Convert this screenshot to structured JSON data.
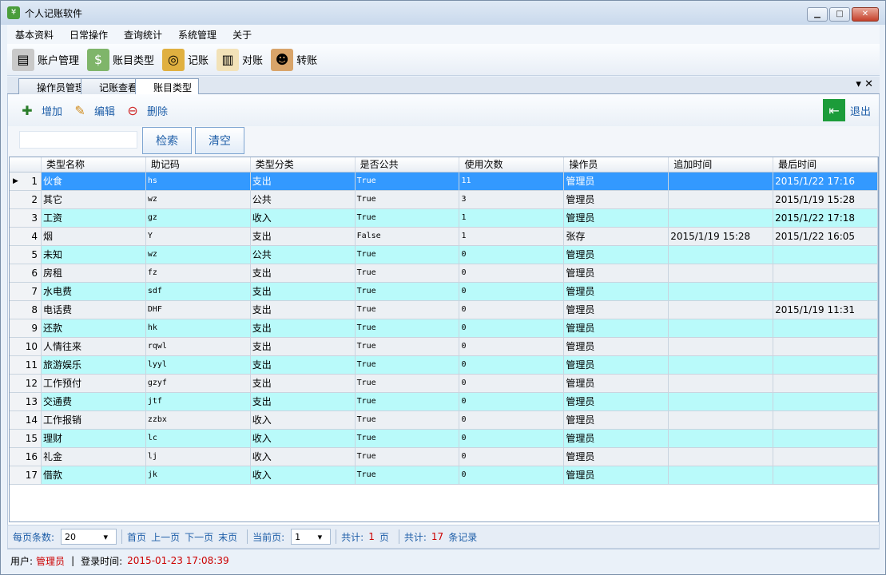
{
  "window": {
    "title": "个人记账软件"
  },
  "menu": [
    "基本资料",
    "日常操作",
    "查询统计",
    "系统管理",
    "关于"
  ],
  "toolbar": [
    {
      "label": "账户管理",
      "icon": "server-icon"
    },
    {
      "label": "账目类型",
      "icon": "money-icon"
    },
    {
      "label": "记账",
      "icon": "coins-icon"
    },
    {
      "label": "对账",
      "icon": "book-icon"
    },
    {
      "label": "转账",
      "icon": "person-briefcase-icon"
    }
  ],
  "tabs": [
    "操作员管理",
    "记账查看",
    "账目类型"
  ],
  "content_toolbar": {
    "add": "增加",
    "edit": "编辑",
    "delete": "删除",
    "exit": "退出"
  },
  "search": {
    "search_label": "检索",
    "clear_label": "清空"
  },
  "grid": {
    "columns": [
      "类型名称",
      "助记码",
      "类型分类",
      "是否公共",
      "使用次数",
      "操作员",
      "追加时间",
      "最后时间"
    ],
    "rows": [
      [
        "1",
        "伙食",
        "hs",
        "支出",
        "True",
        "11",
        "管理员",
        "",
        "2015/1/22 17:16"
      ],
      [
        "2",
        "其它",
        "wz",
        "公共",
        "True",
        "3",
        "管理员",
        "",
        "2015/1/19 15:28"
      ],
      [
        "3",
        "工资",
        "gz",
        "收入",
        "True",
        "1",
        "管理员",
        "",
        "2015/1/22 17:18"
      ],
      [
        "4",
        "烟",
        "Y",
        "支出",
        "False",
        "1",
        "张存",
        "2015/1/19 15:28",
        "2015/1/22 16:05"
      ],
      [
        "5",
        "未知",
        "wz",
        "公共",
        "True",
        "0",
        "管理员",
        "",
        ""
      ],
      [
        "6",
        "房租",
        "fz",
        "支出",
        "True",
        "0",
        "管理员",
        "",
        ""
      ],
      [
        "7",
        "水电费",
        "sdf",
        "支出",
        "True",
        "0",
        "管理员",
        "",
        ""
      ],
      [
        "8",
        "电话费",
        "DHF",
        "支出",
        "True",
        "0",
        "管理员",
        "",
        "2015/1/19 11:31"
      ],
      [
        "9",
        "还款",
        "hk",
        "支出",
        "True",
        "0",
        "管理员",
        "",
        ""
      ],
      [
        "10",
        "人情往来",
        "rqwl",
        "支出",
        "True",
        "0",
        "管理员",
        "",
        ""
      ],
      [
        "11",
        "旅游娱乐",
        "lyyl",
        "支出",
        "True",
        "0",
        "管理员",
        "",
        ""
      ],
      [
        "12",
        "工作预付",
        "gzyf",
        "支出",
        "True",
        "0",
        "管理员",
        "",
        ""
      ],
      [
        "13",
        "交通费",
        "jtf",
        "支出",
        "True",
        "0",
        "管理员",
        "",
        ""
      ],
      [
        "14",
        "工作报销",
        "zzbx",
        "收入",
        "True",
        "0",
        "管理员",
        "",
        ""
      ],
      [
        "15",
        "理财",
        "lc",
        "收入",
        "True",
        "0",
        "管理员",
        "",
        ""
      ],
      [
        "16",
        "礼金",
        "lj",
        "收入",
        "True",
        "0",
        "管理员",
        "",
        ""
      ],
      [
        "17",
        "借款",
        "jk",
        "收入",
        "True",
        "0",
        "管理员",
        "",
        ""
      ]
    ]
  },
  "pager": {
    "per_page_label": "每页条数:",
    "per_page": "20",
    "first": "首页",
    "prev": "上一页",
    "next": "下一页",
    "last": "末页",
    "current_label": "当前页:",
    "current": "1",
    "total_label": "共计:",
    "total_pages": "1",
    "page_unit": "页",
    "total_label2": "共计:",
    "total_records": "17",
    "record_unit": "条记录"
  },
  "status": {
    "user_label": "用户:",
    "user": "管理员",
    "sep": "|",
    "login_label": "登录时间:",
    "login_time": "2015-01-23 17:08:39"
  }
}
